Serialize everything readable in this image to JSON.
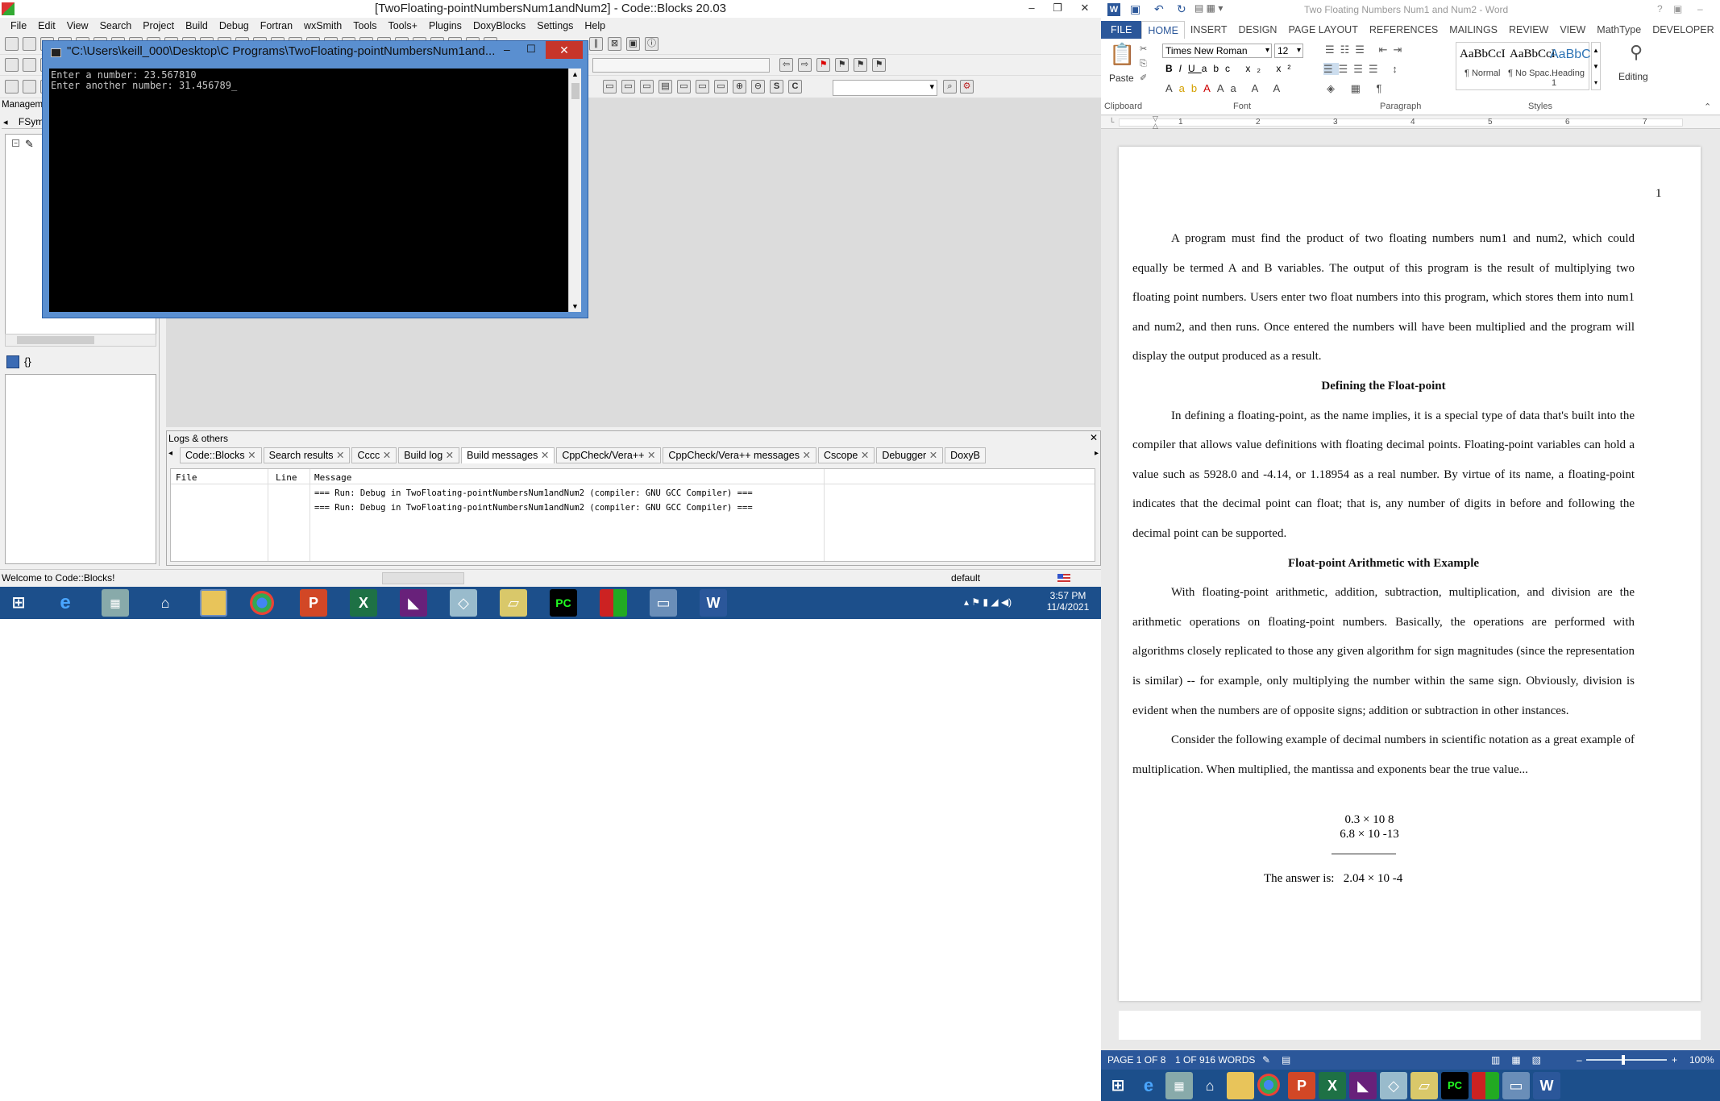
{
  "codeblocks": {
    "title": "[TwoFloating-pointNumbersNum1andNum2] - Code::Blocks 20.03",
    "menu": [
      "File",
      "Edit",
      "View",
      "Search",
      "Project",
      "Build",
      "Debug",
      "Fortran",
      "wxSmith",
      "Tools",
      "Tools+",
      "Plugins",
      "DoxyBlocks",
      "Settings",
      "Help"
    ],
    "management_label": "Manageme",
    "fsym_label": "FSym",
    "braces_label": "{}",
    "logs": {
      "title": "Logs & others",
      "tabs": [
        "Code::Blocks",
        "Search results",
        "Cccc",
        "Build log",
        "Build messages",
        "CppCheck/Vera++",
        "CppCheck/Vera++ messages",
        "Cscope",
        "Debugger",
        "DoxyB"
      ],
      "columns": [
        "File",
        "Line",
        "Message"
      ],
      "rows": [
        "=== Run: Debug in TwoFloating-pointNumbersNum1andNum2 (compiler: GNU GCC Compiler) ===",
        "=== Run: Debug in TwoFloating-pointNumbersNum1andNum2 (compiler: GNU GCC Compiler) ==="
      ]
    },
    "status_left": "Welcome to Code::Blocks!",
    "status_default": "default"
  },
  "console": {
    "title": "\"C:\\Users\\keill_000\\Desktop\\C Programs\\TwoFloating-pointNumbersNum1and...",
    "line1": "Enter a number: 23.567810",
    "line2": "Enter another number: 31.456789_"
  },
  "taskbar_top": {
    "time": "3:57 PM",
    "date": "11/4/2021"
  },
  "word": {
    "title": "Two Floating Numbers Num1 and Num2 - Word",
    "tabs": [
      "FILE",
      "HOME",
      "INSERT",
      "DESIGN",
      "PAGE LAYOUT",
      "REFERENCES",
      "MAILINGS",
      "REVIEW",
      "VIEW",
      "MathType",
      "DEVELOPER"
    ],
    "active_tab": "HOME",
    "font_name": "Times New Roman",
    "font_size": "12",
    "groups": [
      "Clipboard",
      "Font",
      "Paragraph",
      "Styles"
    ],
    "paste_label": "Paste",
    "editing_label": "Editing",
    "styles": [
      {
        "sample": "AaBbCcI",
        "name": "¶ Normal"
      },
      {
        "sample": "AaBbCcI",
        "name": "¶ No Spac..."
      },
      {
        "sample": "AaBbC(",
        "name": "Heading 1"
      }
    ],
    "ruler_numbers": [
      "1",
      "2",
      "3",
      "4",
      "5",
      "6",
      "7"
    ],
    "page_number": "1",
    "paragraphs": [
      "A program must find the product of two floating numbers num1 and num2, which could equally be termed A and B variables. The output of this program is the result of multiplying two floating point numbers. Users enter two float numbers into this program, which stores them into num1 and num2, and then runs. Once entered the numbers will have been multiplied and the program will display the output produced as a result.",
      "In defining a floating-point, as the name implies, it is a special type of data that's built into the compiler that allows value definitions with floating decimal points. Floating-point variables can hold a value such as 5928.0 and -4.14, or 1.18954 as a real number. By virtue of its name, a floating-point indicates that the decimal point can float; that is, any number of digits in before and following the decimal point can be supported.",
      "With floating-point arithmetic, addition, subtraction, multiplication, and division are the arithmetic operations on floating-point numbers. Basically, the operations are performed with algorithms closely replicated to those any given algorithm for sign magnitudes (since the representation is similar) -- for example, only multiplying the number within the same sign. Obviously, division is evident when the numbers are of opposite signs; addition or subtraction in other instances.",
      "Consider the following example of decimal numbers in scientific notation as a great example of multiplication. When multiplied, the mantissa and exponents bear the true value..."
    ],
    "heading1": "Defining the Float-point",
    "heading2": "Float-point Arithmetic with Example",
    "math_line1": "0.3 × 10 8",
    "math_line2": "6.8 × 10 -13",
    "answer_label": "The answer is:",
    "answer_value": "2.04 × 10 -4",
    "status_page": "PAGE 1 OF 8",
    "status_words": "1 OF 916 WORDS",
    "zoom": "100%"
  }
}
